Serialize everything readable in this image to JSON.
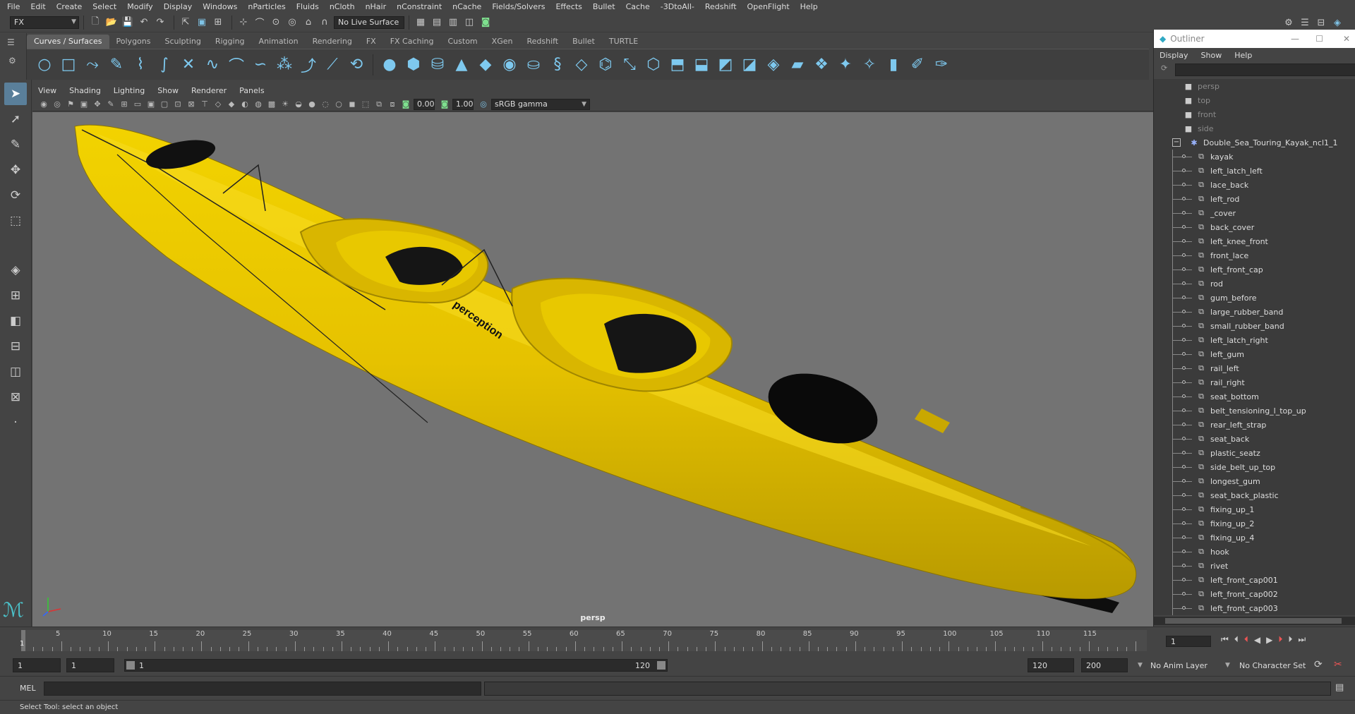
{
  "menubar": [
    "File",
    "Edit",
    "Create",
    "Select",
    "Modify",
    "Display",
    "Windows",
    "nParticles",
    "Fluids",
    "nCloth",
    "nHair",
    "nConstraint",
    "nCache",
    "Fields/Solvers",
    "Effects",
    "Bullet",
    "Cache",
    "-3DtoAll-",
    "Redshift",
    "OpenFlight",
    "Help"
  ],
  "statusline": {
    "mode": "FX",
    "live_surface": "No Live Surface"
  },
  "shelf_tabs": [
    "Curves / Surfaces",
    "Polygons",
    "Sculpting",
    "Rigging",
    "Animation",
    "Rendering",
    "FX",
    "FX Caching",
    "Custom",
    "XGen",
    "Redshift",
    "Bullet",
    "TURTLE"
  ],
  "viewport": {
    "menus": [
      "View",
      "Shading",
      "Lighting",
      "Show",
      "Renderer",
      "Panels"
    ],
    "exposure": "0.00",
    "gamma": "1.00",
    "color_space": "sRGB gamma",
    "camera": "persp",
    "kayak_brand": "perception"
  },
  "colors": {
    "kayak": "#e8c400",
    "accent": "#5a7f9a",
    "viewport_bg": "#737373"
  },
  "outliner": {
    "title": "Outliner",
    "menus": [
      "Display",
      "Show",
      "Help"
    ],
    "cameras": [
      "persp",
      "top",
      "front",
      "side"
    ],
    "root": "Double_Sea_Touring_Kayak_ncl1_1",
    "items": [
      "kayak",
      "left_latch_left",
      "lace_back",
      "left_rod",
      "_cover",
      "back_cover",
      "left_knee_front",
      "front_lace",
      "left_front_cap",
      "rod",
      "gum_before",
      "large_rubber_band",
      "small_rubber_band",
      "left_latch_right",
      "left_gum",
      "rail_left",
      "rail_right",
      "seat_bottom",
      "belt_tensioning_l_top_up",
      "rear_left_strap",
      "seat_back",
      "plastic_seatz",
      "side_belt_up_top",
      "longest_gum",
      "seat_back_plastic",
      "fixing_up_1",
      "fixing_up_2",
      "fixing_up_4",
      "hook",
      "rivet",
      "left_front_cap001",
      "left_front_cap002",
      "left_front_cap003"
    ]
  },
  "timeline": {
    "ticks": [
      "5",
      "10",
      "15",
      "20",
      "25",
      "30",
      "35",
      "40",
      "45",
      "50",
      "55",
      "60",
      "65",
      "70",
      "75",
      "80",
      "85",
      "90",
      "95",
      "100",
      "105",
      "110",
      "115"
    ],
    "current_frame": "1",
    "current_field": "1"
  },
  "range": {
    "start": "1",
    "start2": "1",
    "range_start": "1",
    "range_end": "120",
    "end": "120",
    "end2": "200",
    "anim_layer": "No Anim Layer",
    "character_set": "No Character Set"
  },
  "cmdline": {
    "lang": "MEL"
  },
  "help_line": "Select Tool: select an object"
}
